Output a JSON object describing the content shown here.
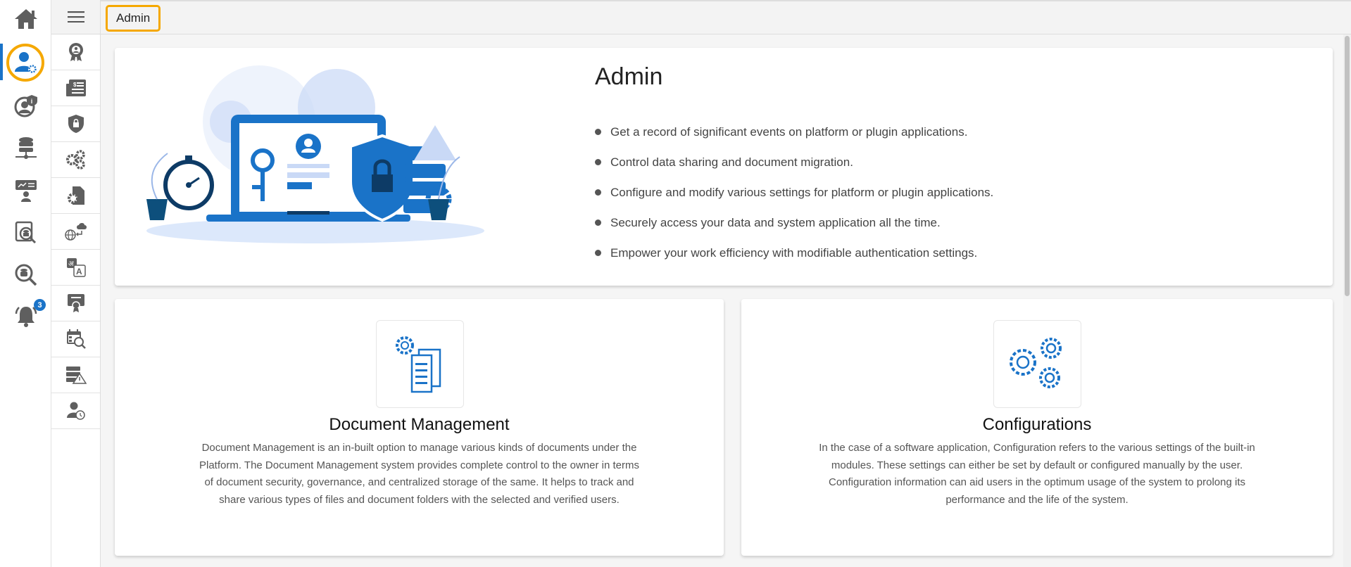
{
  "breadcrumb": "Admin",
  "notifications": {
    "count": "3"
  },
  "rail": [
    "home-icon",
    "user-settings-icon",
    "user-info-icon",
    "database-network-icon",
    "presentation-user-icon",
    "data-catalog-search-icon",
    "database-search-icon",
    "bell-icon"
  ],
  "submenu": [
    "award-user-icon",
    "billing-icon",
    "shield-lock-icon",
    "gears-icon",
    "document-gear-icon",
    "globe-cloud-icon",
    "language-translate-icon",
    "certificate-icon",
    "calendar-search-icon",
    "server-warning-icon",
    "user-history-icon"
  ],
  "hero": {
    "title": "Admin",
    "bullets": [
      "Get a record of significant events on platform or plugin applications.",
      "Control data sharing and document migration.",
      "Configure and modify various settings for platform or plugin applications.",
      "Securely access your data and system application all the time.",
      "Empower your work efficiency with modifiable authentication settings."
    ]
  },
  "modules": [
    {
      "title": "Document Management",
      "description": "Document Management is an in-built option to manage various kinds of documents under the Platform. The Document Management system provides complete control to the owner in terms of document security, governance, and centralized storage of the same. It helps to track and share various types of files and document folders with the selected and verified users."
    },
    {
      "title": "Configurations",
      "description": "In the case of a software application, Configuration refers to the various settings of the built-in modules. These settings can either be set by default or configured manually by the user. Configuration information can aid users in the optimum usage of the system to prolong its performance and the life of the system."
    }
  ],
  "colors": {
    "accent": "#1a73c8",
    "highlight": "#f5a800",
    "icon": "#5f5f5f"
  }
}
